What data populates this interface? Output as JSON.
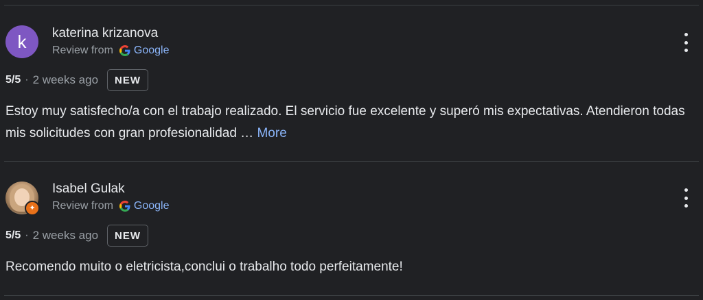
{
  "reviews": [
    {
      "avatar_letter": "k",
      "avatar_color": "#7e57c2",
      "name": "katerina krizanova",
      "source_prefix": "Review from",
      "source_name": "Google",
      "rating": "5/5",
      "separator": "·",
      "date": "2 weeks ago",
      "badge": "NEW",
      "text": "Estoy muy satisfecho/a con el trabajo realizado. El servicio fue excelente y superó mis expectativas. Atendieron todas mis solicitudes con gran profesionalidad …",
      "more_label": "More"
    },
    {
      "avatar_icon": "local-guide-star-icon",
      "name": "Isabel Gulak",
      "source_prefix": "Review from",
      "source_name": "Google",
      "rating": "5/5",
      "separator": "·",
      "date": "2 weeks ago",
      "badge": "NEW",
      "text": "Recomendo muito o eletricista,conclui o trabalho todo perfeitamente!"
    }
  ],
  "colors": {
    "background": "#202124",
    "link": "#8ab4f8",
    "muted": "#9aa0a6",
    "local_guide_badge": "#e8711a"
  }
}
